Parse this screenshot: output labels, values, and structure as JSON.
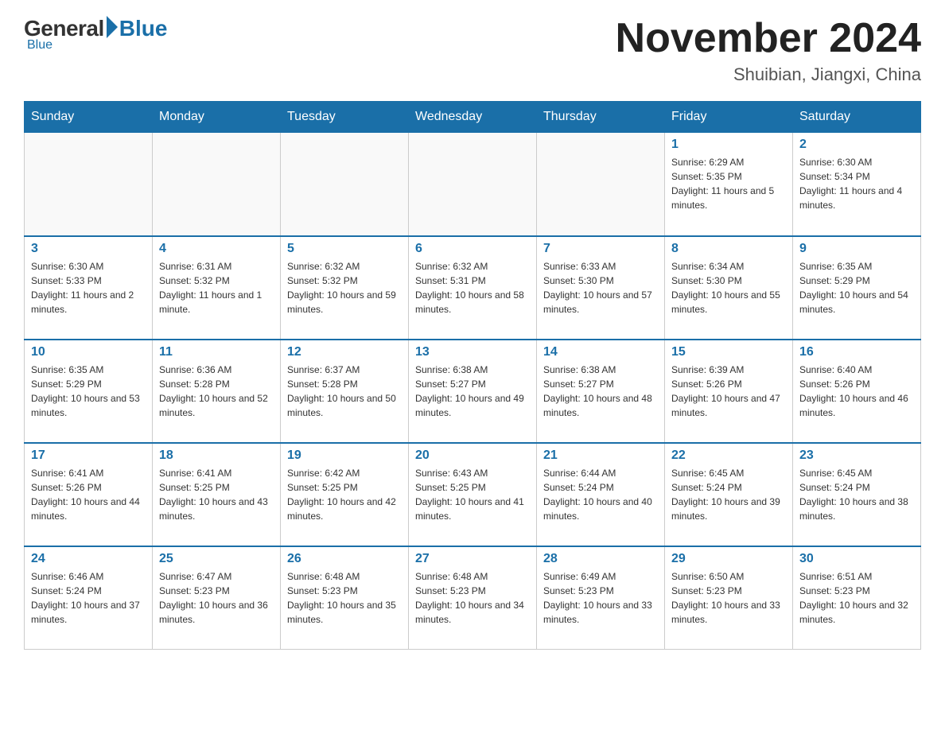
{
  "header": {
    "logo": {
      "general_text": "General",
      "blue_text": "Blue"
    },
    "title": "November 2024",
    "subtitle": "Shuibian, Jiangxi, China"
  },
  "weekdays": [
    "Sunday",
    "Monday",
    "Tuesday",
    "Wednesday",
    "Thursday",
    "Friday",
    "Saturday"
  ],
  "weeks": [
    [
      {
        "day": "",
        "sunrise": "",
        "sunset": "",
        "daylight": ""
      },
      {
        "day": "",
        "sunrise": "",
        "sunset": "",
        "daylight": ""
      },
      {
        "day": "",
        "sunrise": "",
        "sunset": "",
        "daylight": ""
      },
      {
        "day": "",
        "sunrise": "",
        "sunset": "",
        "daylight": ""
      },
      {
        "day": "",
        "sunrise": "",
        "sunset": "",
        "daylight": ""
      },
      {
        "day": "1",
        "sunrise": "Sunrise: 6:29 AM",
        "sunset": "Sunset: 5:35 PM",
        "daylight": "Daylight: 11 hours and 5 minutes."
      },
      {
        "day": "2",
        "sunrise": "Sunrise: 6:30 AM",
        "sunset": "Sunset: 5:34 PM",
        "daylight": "Daylight: 11 hours and 4 minutes."
      }
    ],
    [
      {
        "day": "3",
        "sunrise": "Sunrise: 6:30 AM",
        "sunset": "Sunset: 5:33 PM",
        "daylight": "Daylight: 11 hours and 2 minutes."
      },
      {
        "day": "4",
        "sunrise": "Sunrise: 6:31 AM",
        "sunset": "Sunset: 5:32 PM",
        "daylight": "Daylight: 11 hours and 1 minute."
      },
      {
        "day": "5",
        "sunrise": "Sunrise: 6:32 AM",
        "sunset": "Sunset: 5:32 PM",
        "daylight": "Daylight: 10 hours and 59 minutes."
      },
      {
        "day": "6",
        "sunrise": "Sunrise: 6:32 AM",
        "sunset": "Sunset: 5:31 PM",
        "daylight": "Daylight: 10 hours and 58 minutes."
      },
      {
        "day": "7",
        "sunrise": "Sunrise: 6:33 AM",
        "sunset": "Sunset: 5:30 PM",
        "daylight": "Daylight: 10 hours and 57 minutes."
      },
      {
        "day": "8",
        "sunrise": "Sunrise: 6:34 AM",
        "sunset": "Sunset: 5:30 PM",
        "daylight": "Daylight: 10 hours and 55 minutes."
      },
      {
        "day": "9",
        "sunrise": "Sunrise: 6:35 AM",
        "sunset": "Sunset: 5:29 PM",
        "daylight": "Daylight: 10 hours and 54 minutes."
      }
    ],
    [
      {
        "day": "10",
        "sunrise": "Sunrise: 6:35 AM",
        "sunset": "Sunset: 5:29 PM",
        "daylight": "Daylight: 10 hours and 53 minutes."
      },
      {
        "day": "11",
        "sunrise": "Sunrise: 6:36 AM",
        "sunset": "Sunset: 5:28 PM",
        "daylight": "Daylight: 10 hours and 52 minutes."
      },
      {
        "day": "12",
        "sunrise": "Sunrise: 6:37 AM",
        "sunset": "Sunset: 5:28 PM",
        "daylight": "Daylight: 10 hours and 50 minutes."
      },
      {
        "day": "13",
        "sunrise": "Sunrise: 6:38 AM",
        "sunset": "Sunset: 5:27 PM",
        "daylight": "Daylight: 10 hours and 49 minutes."
      },
      {
        "day": "14",
        "sunrise": "Sunrise: 6:38 AM",
        "sunset": "Sunset: 5:27 PM",
        "daylight": "Daylight: 10 hours and 48 minutes."
      },
      {
        "day": "15",
        "sunrise": "Sunrise: 6:39 AM",
        "sunset": "Sunset: 5:26 PM",
        "daylight": "Daylight: 10 hours and 47 minutes."
      },
      {
        "day": "16",
        "sunrise": "Sunrise: 6:40 AM",
        "sunset": "Sunset: 5:26 PM",
        "daylight": "Daylight: 10 hours and 46 minutes."
      }
    ],
    [
      {
        "day": "17",
        "sunrise": "Sunrise: 6:41 AM",
        "sunset": "Sunset: 5:26 PM",
        "daylight": "Daylight: 10 hours and 44 minutes."
      },
      {
        "day": "18",
        "sunrise": "Sunrise: 6:41 AM",
        "sunset": "Sunset: 5:25 PM",
        "daylight": "Daylight: 10 hours and 43 minutes."
      },
      {
        "day": "19",
        "sunrise": "Sunrise: 6:42 AM",
        "sunset": "Sunset: 5:25 PM",
        "daylight": "Daylight: 10 hours and 42 minutes."
      },
      {
        "day": "20",
        "sunrise": "Sunrise: 6:43 AM",
        "sunset": "Sunset: 5:25 PM",
        "daylight": "Daylight: 10 hours and 41 minutes."
      },
      {
        "day": "21",
        "sunrise": "Sunrise: 6:44 AM",
        "sunset": "Sunset: 5:24 PM",
        "daylight": "Daylight: 10 hours and 40 minutes."
      },
      {
        "day": "22",
        "sunrise": "Sunrise: 6:45 AM",
        "sunset": "Sunset: 5:24 PM",
        "daylight": "Daylight: 10 hours and 39 minutes."
      },
      {
        "day": "23",
        "sunrise": "Sunrise: 6:45 AM",
        "sunset": "Sunset: 5:24 PM",
        "daylight": "Daylight: 10 hours and 38 minutes."
      }
    ],
    [
      {
        "day": "24",
        "sunrise": "Sunrise: 6:46 AM",
        "sunset": "Sunset: 5:24 PM",
        "daylight": "Daylight: 10 hours and 37 minutes."
      },
      {
        "day": "25",
        "sunrise": "Sunrise: 6:47 AM",
        "sunset": "Sunset: 5:23 PM",
        "daylight": "Daylight: 10 hours and 36 minutes."
      },
      {
        "day": "26",
        "sunrise": "Sunrise: 6:48 AM",
        "sunset": "Sunset: 5:23 PM",
        "daylight": "Daylight: 10 hours and 35 minutes."
      },
      {
        "day": "27",
        "sunrise": "Sunrise: 6:48 AM",
        "sunset": "Sunset: 5:23 PM",
        "daylight": "Daylight: 10 hours and 34 minutes."
      },
      {
        "day": "28",
        "sunrise": "Sunrise: 6:49 AM",
        "sunset": "Sunset: 5:23 PM",
        "daylight": "Daylight: 10 hours and 33 minutes."
      },
      {
        "day": "29",
        "sunrise": "Sunrise: 6:50 AM",
        "sunset": "Sunset: 5:23 PM",
        "daylight": "Daylight: 10 hours and 33 minutes."
      },
      {
        "day": "30",
        "sunrise": "Sunrise: 6:51 AM",
        "sunset": "Sunset: 5:23 PM",
        "daylight": "Daylight: 10 hours and 32 minutes."
      }
    ]
  ]
}
